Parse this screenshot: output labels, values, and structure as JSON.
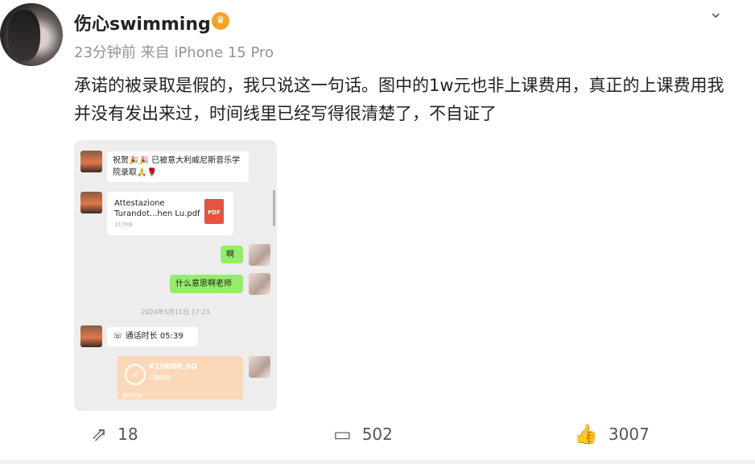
{
  "post": {
    "username": "伤心swimming",
    "vip_icon": "crown-badge-icon",
    "meta": "23分钟前 来自 iPhone 15 Pro",
    "text": "承诺的被录取是假的，我只说这一句话。图中的1w元也非上课费用，真正的上课费用我并没有发出来过，时间线里已经写得很清楚了，不自证了"
  },
  "chat": {
    "msg1": "祝贺🎉🎉 已被意大利威尼斯音乐学院录取🙏🌹",
    "file_name": "Attestazione Turandot...hen Lu.pdf",
    "file_size": "317KB",
    "pdf_label": "PDF",
    "msg_ah": "啊",
    "msg_meaning": "什么意思啊老师",
    "timestamp": "2024年5月11日 17:23",
    "call": "通话时长 05:39",
    "transfer_amount": "¥10000.00",
    "transfer_status": "已被接收",
    "transfer_footer": "微信转账"
  },
  "actions": {
    "share_count": "18",
    "comment_count": "502",
    "like_count": "3007"
  }
}
